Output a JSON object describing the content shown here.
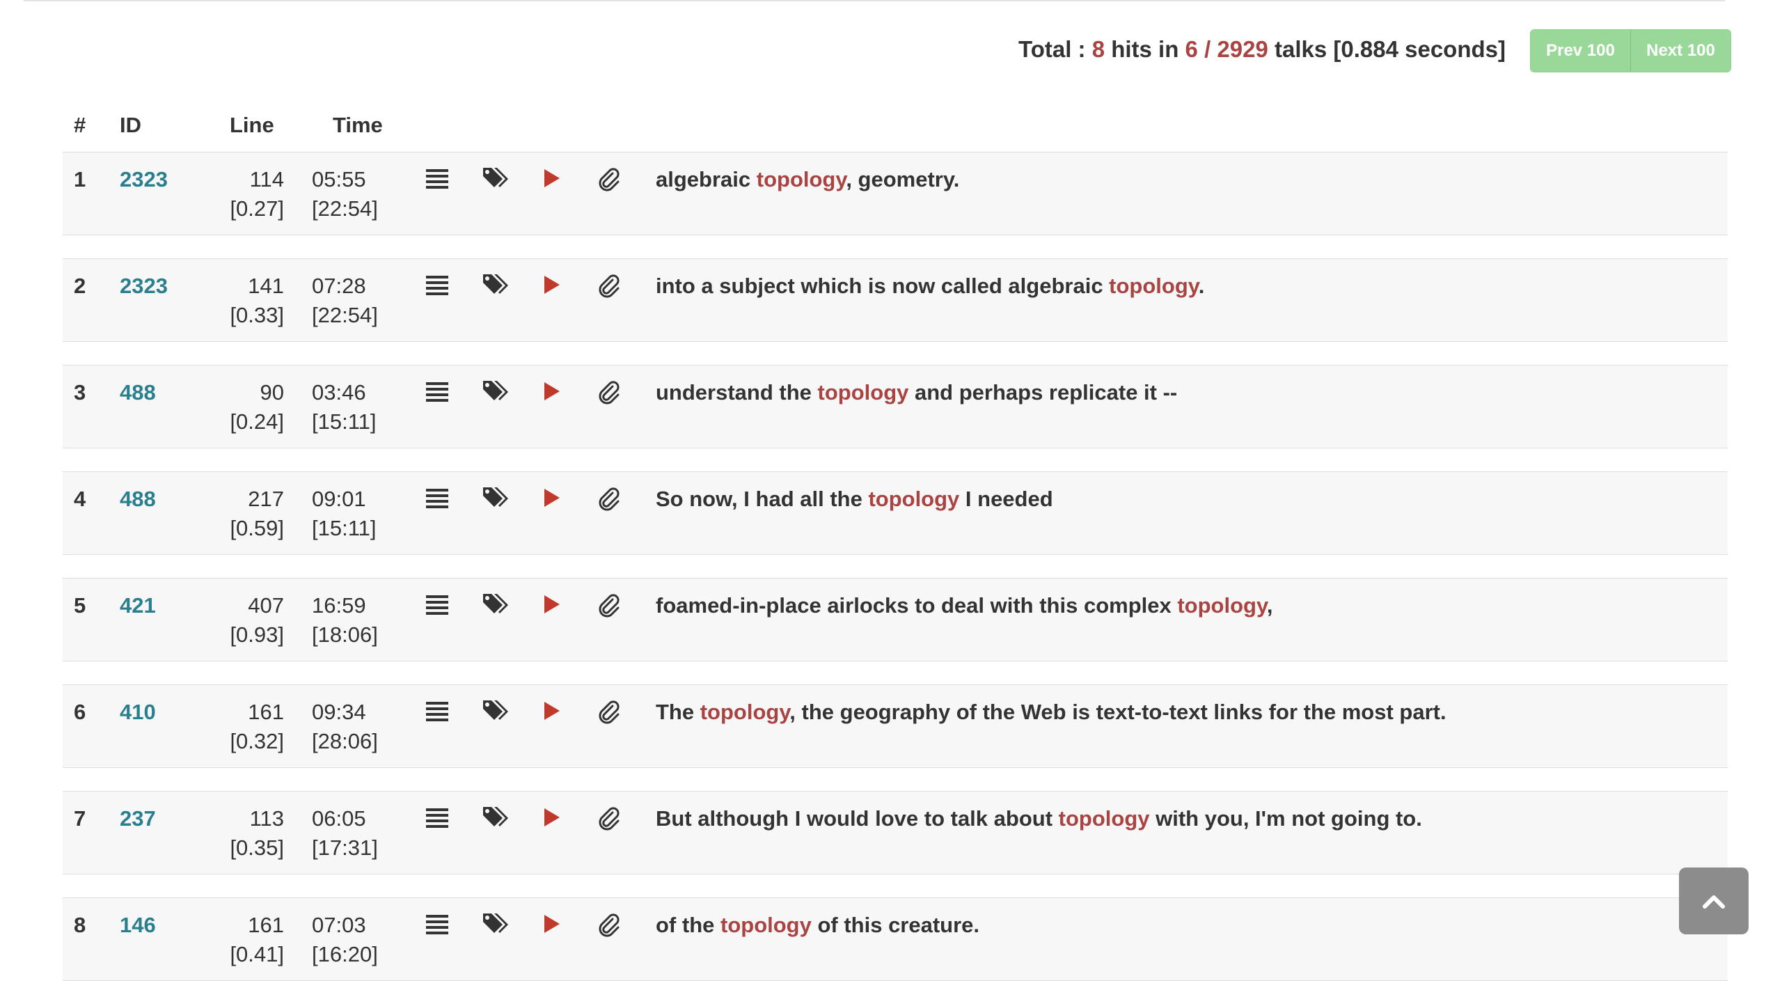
{
  "summary": {
    "prefix": "Total : ",
    "hits": "8",
    "hits_word": " hits in ",
    "talks_ratio": "6 / 2929",
    "suffix": " talks [0.884 seconds]"
  },
  "pager": {
    "prev_label": "Prev 100",
    "next_label": "Next 100"
  },
  "table": {
    "headers": {
      "num": "#",
      "id": "ID",
      "line": "Line",
      "time": "Time"
    },
    "rows": [
      {
        "num": "1",
        "id": "2323",
        "line": "114",
        "line_frac": "[0.27]",
        "time": "05:55",
        "duration": "[22:54]",
        "pre": "algebraic ",
        "hit": "topology",
        "post": ", geometry."
      },
      {
        "num": "2",
        "id": "2323",
        "line": "141",
        "line_frac": "[0.33]",
        "time": "07:28",
        "duration": "[22:54]",
        "pre": "into a subject which is now called algebraic ",
        "hit": "topology",
        "post": "."
      },
      {
        "num": "3",
        "id": "488",
        "line": "90",
        "line_frac": "[0.24]",
        "time": "03:46",
        "duration": "[15:11]",
        "pre": "understand the ",
        "hit": "topology",
        "post": " and perhaps replicate it --"
      },
      {
        "num": "4",
        "id": "488",
        "line": "217",
        "line_frac": "[0.59]",
        "time": "09:01",
        "duration": "[15:11]",
        "pre": "So now, I had all the ",
        "hit": "topology",
        "post": " I needed"
      },
      {
        "num": "5",
        "id": "421",
        "line": "407",
        "line_frac": "[0.93]",
        "time": "16:59",
        "duration": "[18:06]",
        "pre": "foamed-in-place airlocks to deal with this complex ",
        "hit": "topology",
        "post": ","
      },
      {
        "num": "6",
        "id": "410",
        "line": "161",
        "line_frac": "[0.32]",
        "time": "09:34",
        "duration": "[28:06]",
        "pre": "The ",
        "hit": "topology",
        "post": ", the geography of the Web is text-to-text links for the most part."
      },
      {
        "num": "7",
        "id": "237",
        "line": "113",
        "line_frac": "[0.35]",
        "time": "06:05",
        "duration": "[17:31]",
        "pre": "But although I would love to talk about ",
        "hit": "topology",
        "post": " with you, I'm not going to."
      },
      {
        "num": "8",
        "id": "146",
        "line": "161",
        "line_frac": "[0.41]",
        "time": "07:03",
        "duration": "[16:20]",
        "pre": "of the ",
        "hit": "topology",
        "post": " of this creature."
      }
    ]
  },
  "icons": {
    "list": "list-icon",
    "tags": "tags-icon",
    "play": "play-icon",
    "clip": "paperclip-icon",
    "scroll_top": "chevron-up-icon"
  },
  "colors": {
    "highlight": "#a94442",
    "link": "#2a7f8e",
    "pager": "#9ad89a",
    "row_bg": "#f7f7f7"
  }
}
